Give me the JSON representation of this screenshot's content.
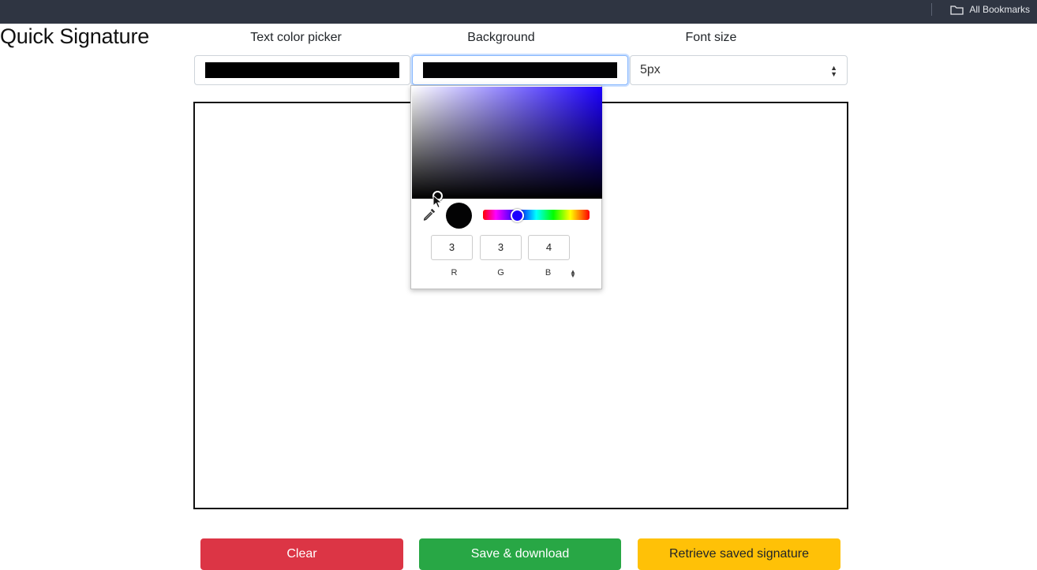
{
  "browser": {
    "bookmarks_label": "All Bookmarks"
  },
  "app": {
    "title": "Quick Signature"
  },
  "controls": {
    "text_color_label": "Text color picker",
    "background_label": "Background",
    "font_size_label": "Font size",
    "text_color_value": "#000000",
    "background_value": "#030304",
    "font_size_value": "5px"
  },
  "color_picker": {
    "hue_color": "#1c00ff",
    "r_value": "3",
    "g_value": "3",
    "b_value": "4",
    "r_label": "R",
    "g_label": "G",
    "b_label": "B",
    "mode_toggle_icon": "up-down-arrows-icon"
  },
  "buttons": {
    "clear_label": "Clear",
    "save_label": "Save & download",
    "retrieve_label": "Retrieve saved signature"
  },
  "colors": {
    "danger": "#dc3545",
    "success": "#28a745",
    "warning": "#ffc107",
    "topbar": "#2f3542"
  }
}
